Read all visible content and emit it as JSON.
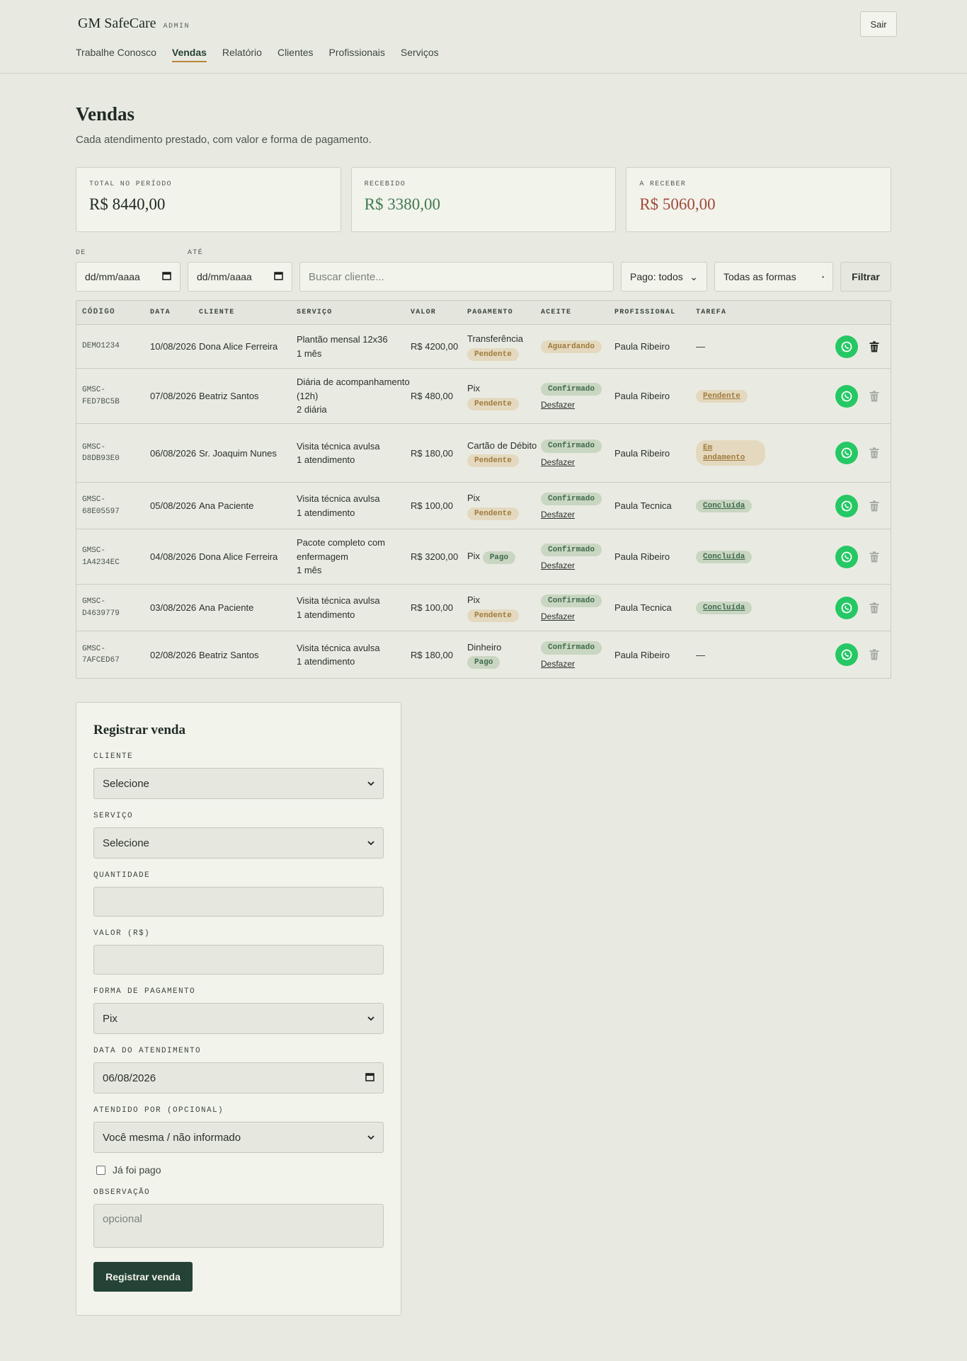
{
  "header": {
    "brand": "GM SafeCare",
    "brand_tag": "ADMIN",
    "logout": "Sair",
    "nav": [
      "Trabalhe Conosco",
      "Vendas",
      "Relatório",
      "Clientes",
      "Profissionais",
      "Serviços"
    ],
    "active_nav": "Vendas"
  },
  "page": {
    "title": "Vendas",
    "subtitle": "Cada atendimento prestado, com valor e forma de pagamento."
  },
  "cards": [
    {
      "label": "TOTAL NO PERÍODO",
      "value": "R$ 8440,00",
      "tone": "neutral"
    },
    {
      "label": "RECEBIDO",
      "value": "R$ 3380,00",
      "tone": "green"
    },
    {
      "label": "A RECEBER",
      "value": "R$ 5060,00",
      "tone": "red"
    }
  ],
  "filters": {
    "from_label": "DE",
    "from_value": "dd/mm/aaaa",
    "to_label": "ATÉ",
    "to_value": "dd/mm/aaaa",
    "search_placeholder": "Buscar cliente...",
    "paid_select": "Pago: todos",
    "method_select": "Todas as formas",
    "filter_button": "Filtrar"
  },
  "table": {
    "headers": [
      "CÓDIGO",
      "DATA",
      "CLIENTE",
      "SERVIÇO",
      "VALOR",
      "PAGAMENTO",
      "ACEITE",
      "PROFISSIONAL",
      "TAREFA"
    ],
    "undo_label": "Desfazer",
    "rows": [
      {
        "code": "DEMO1234",
        "date": "10/08/2026",
        "client": "Dona Alice Ferreira",
        "service": "Plantão mensal 12x36",
        "qty": "1 mês",
        "value": "R$ 4200,00",
        "pay_method": "Transferência",
        "pay_status": "Pendente",
        "accept": "Aguardando",
        "professional": "Paula Ribeiro",
        "task": "—"
      },
      {
        "code": "GMSC-\nFED7BC5B",
        "date": "07/08/2026",
        "client": "Beatriz Santos",
        "service": "Diária de acompanhamento (12h)",
        "qty": "2 diária",
        "value": "R$ 480,00",
        "pay_method": "Pix",
        "pay_status": "Pendente",
        "accept": "Confirmado",
        "professional": "Paula Ribeiro",
        "task": "Pendente"
      },
      {
        "code": "GMSC-\nD8DB93E0",
        "date": "06/08/2026",
        "client": "Sr. Joaquim Nunes",
        "service": "Visita técnica avulsa",
        "qty": "1 atendimento",
        "value": "R$ 180,00",
        "pay_method": "Cartão de Débito",
        "pay_status": "Pendente",
        "accept": "Confirmado",
        "professional": "Paula Ribeiro",
        "task": "Em andamento"
      },
      {
        "code": "GMSC-\n68E05597",
        "date": "05/08/2026",
        "client": "Ana Paciente",
        "service": "Visita técnica avulsa",
        "qty": "1 atendimento",
        "value": "R$ 100,00",
        "pay_method": "Pix",
        "pay_status": "Pendente",
        "accept": "Confirmado",
        "professional": "Paula Tecnica",
        "task": "Concluída"
      },
      {
        "code": "GMSC-\n1A4234EC",
        "date": "04/08/2026",
        "client": "Dona Alice Ferreira",
        "service": "Pacote completo com enfermagem",
        "qty": "1 mês",
        "value": "R$ 3200,00",
        "pay_method": "Pix",
        "pay_status": "Pago",
        "accept": "Confirmado",
        "professional": "Paula Ribeiro",
        "task": "Concluída"
      },
      {
        "code": "GMSC-\nD4639779",
        "date": "03/08/2026",
        "client": "Ana Paciente",
        "service": "Visita técnica avulsa",
        "qty": "1 atendimento",
        "value": "R$ 100,00",
        "pay_method": "Pix",
        "pay_status": "Pendente",
        "accept": "Confirmado",
        "professional": "Paula Tecnica",
        "task": "Concluída"
      },
      {
        "code": "GMSC-\n7AFCED67",
        "date": "02/08/2026",
        "client": "Beatriz Santos",
        "service": "Visita técnica avulsa",
        "qty": "1 atendimento",
        "value": "R$ 180,00",
        "pay_method": "Dinheiro",
        "pay_status": "Pago",
        "accept": "Confirmado",
        "professional": "Paula Ribeiro",
        "task": "—"
      }
    ]
  },
  "form": {
    "title": "Registrar venda",
    "client_label": "CLIENTE",
    "client_value": "Selecione",
    "service_label": "SERVIÇO",
    "service_value": "Selecione",
    "qty_label": "QUANTIDADE",
    "qty_value": "",
    "value_label": "VALOR (R$)",
    "value_value": "",
    "method_label": "FORMA DE PAGAMENTO",
    "method_value": "Pix",
    "date_label": "DATA DO ATENDIMENTO",
    "date_value": "06/08/2026",
    "by_label": "ATENDIDO POR (OPCIONAL)",
    "by_value": "Você mesma / não informado",
    "paid_check": "Já foi pago",
    "note_label": "OBSERVAÇÃO",
    "note_placeholder": "opcional",
    "submit": "Registrar venda"
  },
  "colors": {
    "accent": "#244236",
    "nav_underline": "#b8863b",
    "received": "#3f7a52",
    "receivable": "#a04a3c",
    "whatsapp": "#25c864"
  }
}
